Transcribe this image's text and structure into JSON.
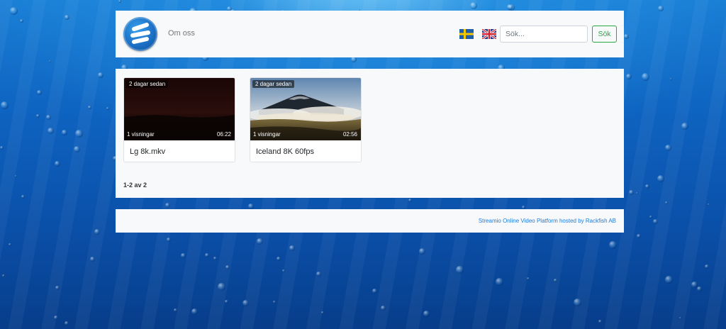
{
  "header": {
    "nav_link": "Om oss",
    "languages": [
      {
        "name": "swedish-flag-icon",
        "code": "sv"
      },
      {
        "name": "uk-flag-icon",
        "code": "en"
      }
    ],
    "search": {
      "placeholder": "Sök...",
      "value": "",
      "button_label": "Sök"
    }
  },
  "videos": [
    {
      "title": "Lg 8k.mkv",
      "age": "2 dagar sedan",
      "views": "1 visningar",
      "duration": "06:22"
    },
    {
      "title": "Iceland 8K 60fps",
      "age": "2 dagar sedan",
      "views": "1 visningar",
      "duration": "02:56"
    }
  ],
  "pagination": "1-2 av 2",
  "footer": {
    "link_text": "Streamio Online Video Platform hosted by Rackfish AB"
  },
  "colors": {
    "accent_green": "#28a745",
    "link_blue": "#1a7cdb",
    "panel_bg": "#f8f9fa"
  }
}
